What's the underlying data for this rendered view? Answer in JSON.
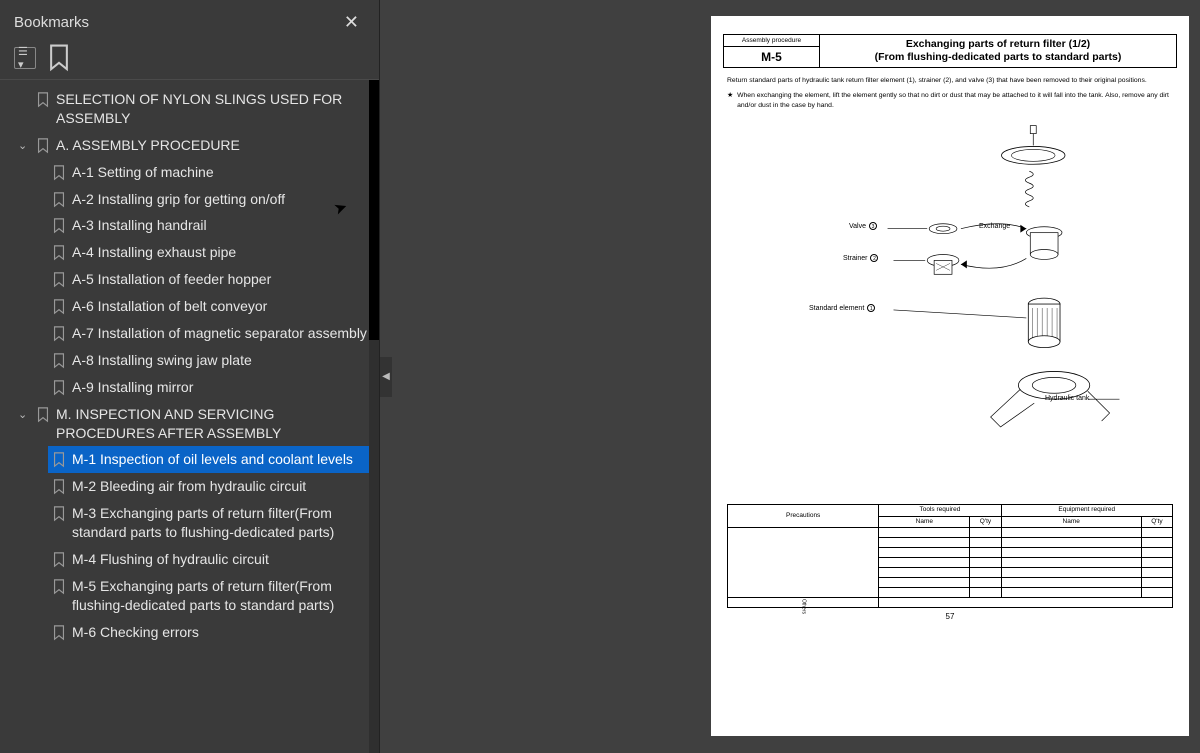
{
  "sidebar": {
    "title": "Bookmarks",
    "items": [
      {
        "level": 0,
        "expand": "",
        "label": "SELECTION OF NYLON SLINGS USED FOR ASSEMBLY",
        "selected": false
      },
      {
        "level": 0,
        "expand": "v",
        "label": "A. ASSEMBLY PROCEDURE",
        "selected": false
      },
      {
        "level": 1,
        "expand": "",
        "label": "A-1  Setting of machine",
        "selected": false
      },
      {
        "level": 1,
        "expand": "",
        "label": "A-2  Installing grip for getting on/off",
        "selected": false
      },
      {
        "level": 1,
        "expand": "",
        "label": "A-3  Installing handrail",
        "selected": false
      },
      {
        "level": 1,
        "expand": "",
        "label": "A-4  Installing exhaust pipe",
        "selected": false
      },
      {
        "level": 1,
        "expand": "",
        "label": "A-5  Installation of feeder hopper",
        "selected": false
      },
      {
        "level": 1,
        "expand": "",
        "label": "A-6  Installation of belt conveyor",
        "selected": false
      },
      {
        "level": 1,
        "expand": "",
        "label": "A-7  Installation of magnetic separator assembly",
        "selected": false
      },
      {
        "level": 1,
        "expand": "",
        "label": "A-8  Installing swing jaw plate",
        "selected": false
      },
      {
        "level": 1,
        "expand": "",
        "label": "A-9  Installing mirror",
        "selected": false
      },
      {
        "level": 0,
        "expand": "v",
        "label": "M. INSPECTION AND SERVICING PROCEDURES AFTER ASSEMBLY",
        "selected": false
      },
      {
        "level": 1,
        "expand": "",
        "label": "M-1  Inspection of oil levels and coolant levels",
        "selected": true
      },
      {
        "level": 1,
        "expand": "",
        "label": "M-2  Bleeding air from hydraulic circuit",
        "selected": false
      },
      {
        "level": 1,
        "expand": "",
        "label": "M-3  Exchanging parts of return filter(From standard parts to flushing-dedicated parts)",
        "selected": false
      },
      {
        "level": 1,
        "expand": "",
        "label": "M-4  Flushing of hydraulic circuit",
        "selected": false
      },
      {
        "level": 1,
        "expand": "",
        "label": "M-5  Exchanging parts of return filter(From flushing-dedicated parts to standard parts)",
        "selected": false
      },
      {
        "level": 1,
        "expand": "",
        "label": "M-6  Checking errors",
        "selected": false
      }
    ]
  },
  "document": {
    "header": {
      "proc_label": "Assembly procedure",
      "proc_code": "M-5",
      "title_line1": "Exchanging parts of return filter (1/2)",
      "title_line2": "(From flushing-dedicated parts to standard parts)"
    },
    "para1": "Return standard parts of hydraulic tank return filter element (1), strainer (2), and valve (3) that have been removed to their original positions.",
    "star": "★",
    "star_note": "When exchanging the element, lift the element gently so that no dirt or dust that may be attached to it will fall into the tank. Also, remove any dirt and/or dust in the case by hand.",
    "diagram_labels": {
      "valve": "Valve",
      "valve_num": "3",
      "strainer": "Strainer",
      "strainer_num": "2",
      "standard_element": "Standard element",
      "standard_num": "1",
      "exchange": "Exchange",
      "hydraulic_tank": "Hydraulic tank"
    },
    "table": {
      "precautions": "Precautions",
      "tools_required": "Tools required",
      "equipment_required": "Equipment required",
      "name": "Name",
      "qty": "Q'ty",
      "others": "Others"
    },
    "page_number": "57"
  }
}
